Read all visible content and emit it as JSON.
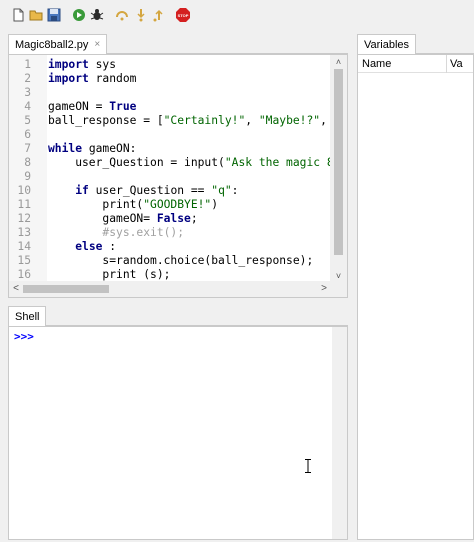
{
  "toolbar": {
    "buttons": [
      "new-file-icon",
      "open-folder-icon",
      "save-icon",
      "run-icon",
      "debug-icon",
      "step-over-icon",
      "step-into-icon",
      "step-out-icon",
      "stop-icon"
    ],
    "stop_label": "STOP"
  },
  "editor": {
    "tab_label": "Magic8ball2.py",
    "tab_close": "×",
    "line_numbers": [
      "1",
      "2",
      "3",
      "4",
      "5",
      "6",
      "7",
      "8",
      "9",
      "10",
      "11",
      "12",
      "13",
      "14",
      "15",
      "16"
    ],
    "code": {
      "l1_kw": "import",
      "l1_rest": " sys",
      "l2_kw": "import",
      "l2_rest": " random",
      "l4_a": "gameON = ",
      "l4_kw": "True",
      "l5_a": "ball_response = [",
      "l5_s1": "\"Certainly!\"",
      "l5_b": ", ",
      "l5_s2": "\"Maybe!?\"",
      "l5_c": ",",
      "l7_kw": "while",
      "l7_rest": " gameON:",
      "l8_a": "    user_Question = input(",
      "l8_s": "\"Ask the magic 8",
      "l10_pre": "    ",
      "l10_kw": "if",
      "l10_a": " user_Question == ",
      "l10_s": "\"q\"",
      "l10_b": ":",
      "l11_a": "        print(",
      "l11_s": "\"GOODBYE!\"",
      "l11_b": ")",
      "l12_a": "        gameON= ",
      "l12_kw": "False",
      "l12_b": ";",
      "l13_pre": "        ",
      "l13_cm": "#sys.exit();",
      "l14_pre": "    ",
      "l14_kw": "else",
      "l14_b": " :",
      "l15": "        s=random.choice(ball_response);",
      "l16": "        print (s);"
    },
    "scroll_up": "˄",
    "scroll_down": "˅",
    "scroll_left": "<",
    "scroll_right": ">"
  },
  "shell": {
    "tab_label": "Shell",
    "prompt": ">>>"
  },
  "variables": {
    "tab_label": "Variables",
    "col_name": "Name",
    "col_value": "Va"
  }
}
